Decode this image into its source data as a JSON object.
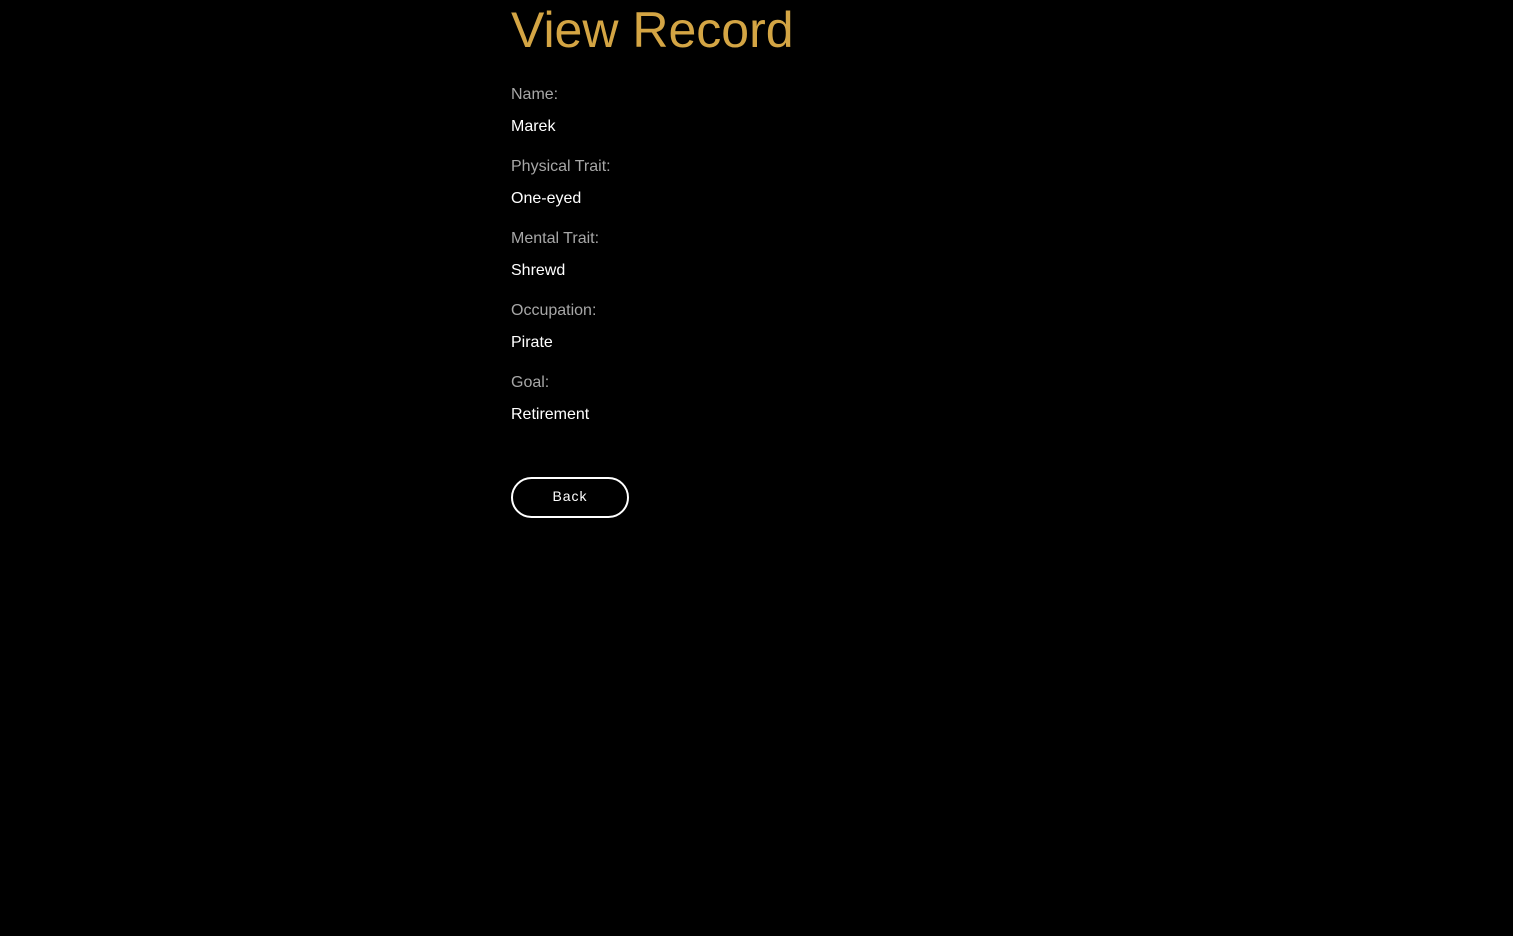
{
  "page": {
    "title": "View Record"
  },
  "record": {
    "fields": [
      {
        "label": "Name:",
        "value": "Marek"
      },
      {
        "label": "Physical Trait:",
        "value": "One-eyed"
      },
      {
        "label": "Mental Trait:",
        "value": "Shrewd"
      },
      {
        "label": "Occupation:",
        "value": "Pirate"
      },
      {
        "label": "Goal:",
        "value": "Retirement"
      }
    ]
  },
  "actions": {
    "back_label": "Back"
  },
  "colors": {
    "background": "#000000",
    "title": "#D4A544",
    "label": "#A7A7A7",
    "value": "#FFFFFF",
    "button_border": "#FFFFFF"
  }
}
